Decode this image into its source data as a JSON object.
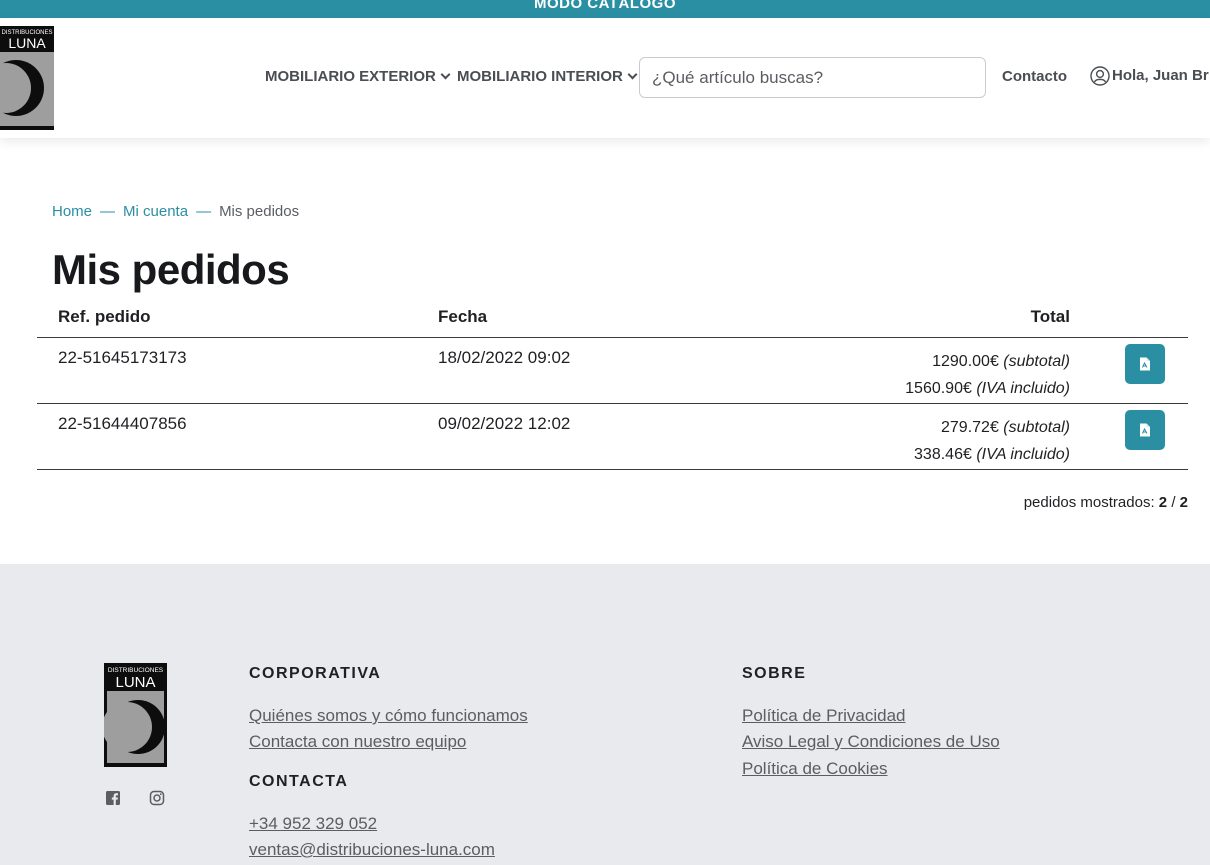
{
  "banner": {
    "text": "MODO CATÁLOGO"
  },
  "brand": {
    "logo_line1": "DISTRIBUCIONES",
    "logo_line2": "LUNA"
  },
  "header": {
    "nav": [
      {
        "label": "MOBILIARIO EXTERIOR"
      },
      {
        "label": "MOBILIARIO INTERIOR"
      }
    ],
    "search_placeholder": "¿Qué artículo buscas?",
    "contact_label": "Contacto",
    "user_greeting": "Hola, Juan Br"
  },
  "breadcrumb": {
    "home": "Home",
    "sep": "—",
    "account": "Mi cuenta",
    "current": "Mis pedidos"
  },
  "page_title": "Mis pedidos",
  "orders": {
    "columns": {
      "ref": "Ref. pedido",
      "date": "Fecha",
      "total": "Total"
    },
    "rows": [
      {
        "ref": "22-51645173173",
        "date": "18/02/2022 09:02",
        "subtotal": "1290.00€",
        "subtotal_note": "(subtotal)",
        "total": "1560.90€",
        "total_note": "(IVA incluido)"
      },
      {
        "ref": "22-51644407856",
        "date": "09/02/2022 12:02",
        "subtotal": "279.72€",
        "subtotal_note": "(subtotal)",
        "total": "338.46€",
        "total_note": "(IVA incluido)"
      }
    ],
    "shown_label": "pedidos mostrados:",
    "shown_count": "2",
    "shown_sep": "/",
    "shown_total": "2"
  },
  "footer": {
    "corporativa": {
      "title": "CORPORATIVA",
      "links": [
        "Quiénes somos y cómo funcionamos",
        "Contacta con nuestro equipo"
      ]
    },
    "contacta": {
      "title": "CONTACTA",
      "phone": "+34 952 329 052",
      "email": "ventas@distribuciones-luna.com"
    },
    "sobre": {
      "title": "SOBRE",
      "links": [
        "Política de Privacidad",
        "Aviso Legal y Condiciones de Uso",
        "Política de Cookies"
      ]
    }
  },
  "colors": {
    "accent": "#2a8fa3",
    "footer_bg": "#e8eaee"
  }
}
